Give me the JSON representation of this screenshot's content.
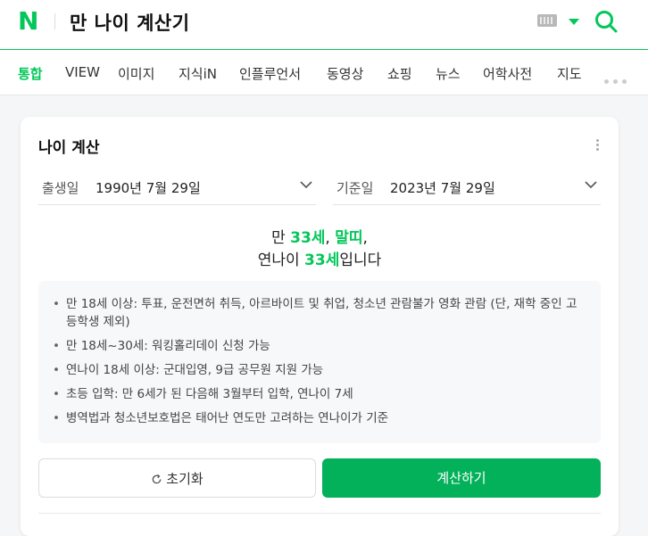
{
  "header": {
    "logo": "N",
    "query": "만 나이 계산기",
    "accent": "#03c75a"
  },
  "tabs": [
    {
      "label": "통합",
      "active": true
    },
    {
      "label": "VIEW"
    },
    {
      "label": "이미지"
    },
    {
      "label": "지식iN"
    },
    {
      "label": "인플루언서"
    },
    {
      "label": "동영상"
    },
    {
      "label": "쇼핑"
    },
    {
      "label": "뉴스"
    },
    {
      "label": "어학사전"
    },
    {
      "label": "지도"
    }
  ],
  "card": {
    "title": "나이 계산",
    "birth": {
      "label": "출생일",
      "value": "1990년 7월 29일"
    },
    "base": {
      "label": "기준일",
      "value": "2023년 7월 29일"
    },
    "result": {
      "line1_prefix": "만 ",
      "age": "33세",
      "sep": ", ",
      "zodiac": "말띠",
      "line1_suffix": ",",
      "line2_prefix": "연나이 ",
      "year_age": "33세",
      "line2_suffix": "입니다"
    },
    "info": [
      "만 18세 이상: 투표, 운전면허 취득, 아르바이트 및 취업, 청소년 관람불가 영화 관람 (단, 재학 중인 고등학생 제외)",
      "만 18세~30세: 워킹홀리데이 신청 가능",
      "연나이 18세 이상: 군대입영, 9급 공무원 지원 가능",
      "초등 입학: 만 6세가 된 다음해 3월부터 입학, 연나이 7세",
      "병역법과 청소년보호법은 태어난 연도만 고려하는 연나이가 기준"
    ],
    "reset_label": "초기화",
    "calc_label": "계산하기"
  }
}
